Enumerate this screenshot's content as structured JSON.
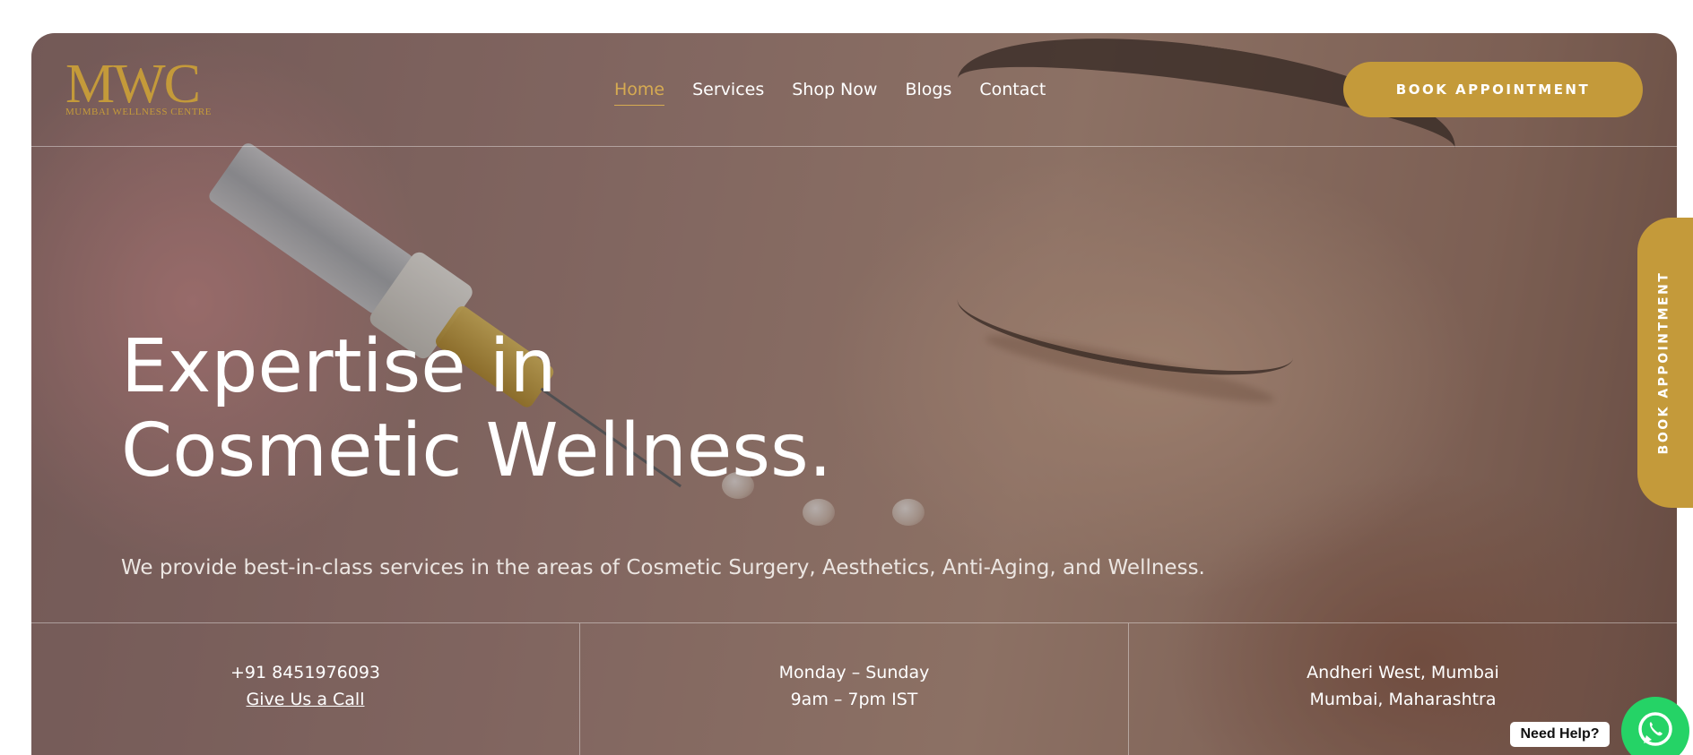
{
  "brand": {
    "logo_mark": "MWC",
    "logo_subtitle": "MUMBAI WELLNESS CENTRE"
  },
  "nav": {
    "items": [
      {
        "label": "Home",
        "active": true
      },
      {
        "label": "Services",
        "active": false
      },
      {
        "label": "Shop Now",
        "active": false
      },
      {
        "label": "Blogs",
        "active": false
      },
      {
        "label": "Contact",
        "active": false
      }
    ]
  },
  "header": {
    "book_button_label": "BOOK APPOINTMENT"
  },
  "hero": {
    "title_line1": "Expertise in",
    "title_line2": "Cosmetic Wellness.",
    "subtitle": "We provide best-in-class services in the areas of Cosmetic Surgery, Aesthetics, Anti-Aging, and Wellness."
  },
  "info": {
    "phone": "+91 8451976093",
    "call_link": "Give Us a Call",
    "days": "Monday – Sunday",
    "hours": "9am – 7pm IST",
    "address_line1": "Andheri West, Mumbai",
    "address_line2": "Mumbai, Maharashtra"
  },
  "side_tab": {
    "label": "BOOK APPOINTMENT"
  },
  "help": {
    "label": "Need Help?",
    "icon": "whatsapp-icon"
  },
  "colors": {
    "accent_gold": "#c49a3a",
    "whatsapp_green": "#25d366"
  }
}
